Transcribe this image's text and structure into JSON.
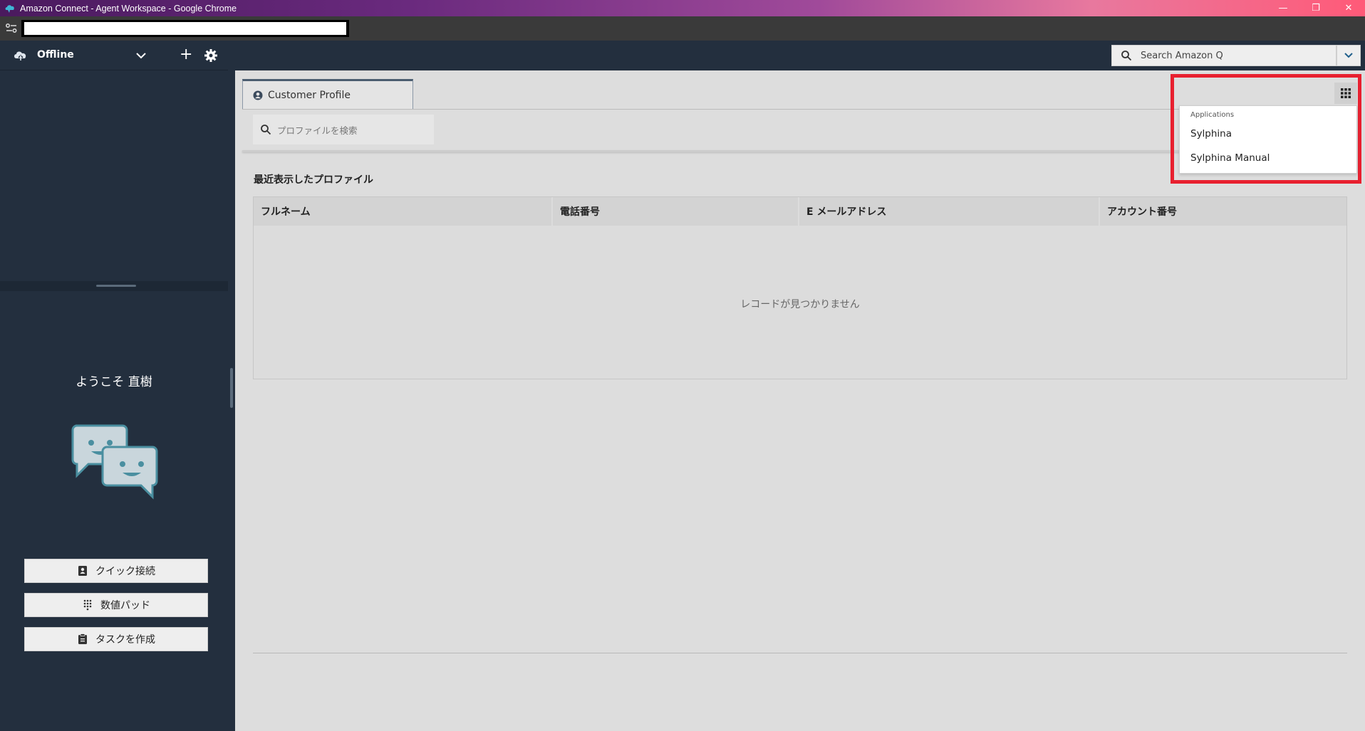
{
  "window": {
    "title": "Amazon Connect - Agent Workspace - Google Chrome",
    "controls": {
      "minimize": "—",
      "restore": "❐",
      "close": "✕"
    }
  },
  "agent": {
    "status": "Offline",
    "welcome": "ようこそ 直樹",
    "buttons": {
      "quick_connect": "クイック接続",
      "number_pad": "数値パッド",
      "create_task": "タスクを作成"
    }
  },
  "header": {
    "search_placeholder": "Search Amazon Q"
  },
  "main": {
    "tab_label": "Customer Profile",
    "profile_search_placeholder": "プロファイルを検索",
    "recent_title": "最近表示したプロファイル",
    "table": {
      "columns": [
        "フルネーム",
        "電話番号",
        "E メールアドレス",
        "アカウント番号"
      ],
      "empty_text": "レコードが見つかりません"
    }
  },
  "apps_menu": {
    "header": "Applications",
    "items": [
      "Sylphina",
      "Sylphina Manual"
    ]
  },
  "colors": {
    "panel_dark": "#232f3e",
    "highlight": "#e8202f",
    "main_bg": "#dddddd"
  },
  "icons": {
    "status": "cloud-icon",
    "dropdown": "chevron-down-icon",
    "add": "plus-icon",
    "settings": "gear-icon",
    "search": "search-icon",
    "apps": "grid-icon"
  }
}
